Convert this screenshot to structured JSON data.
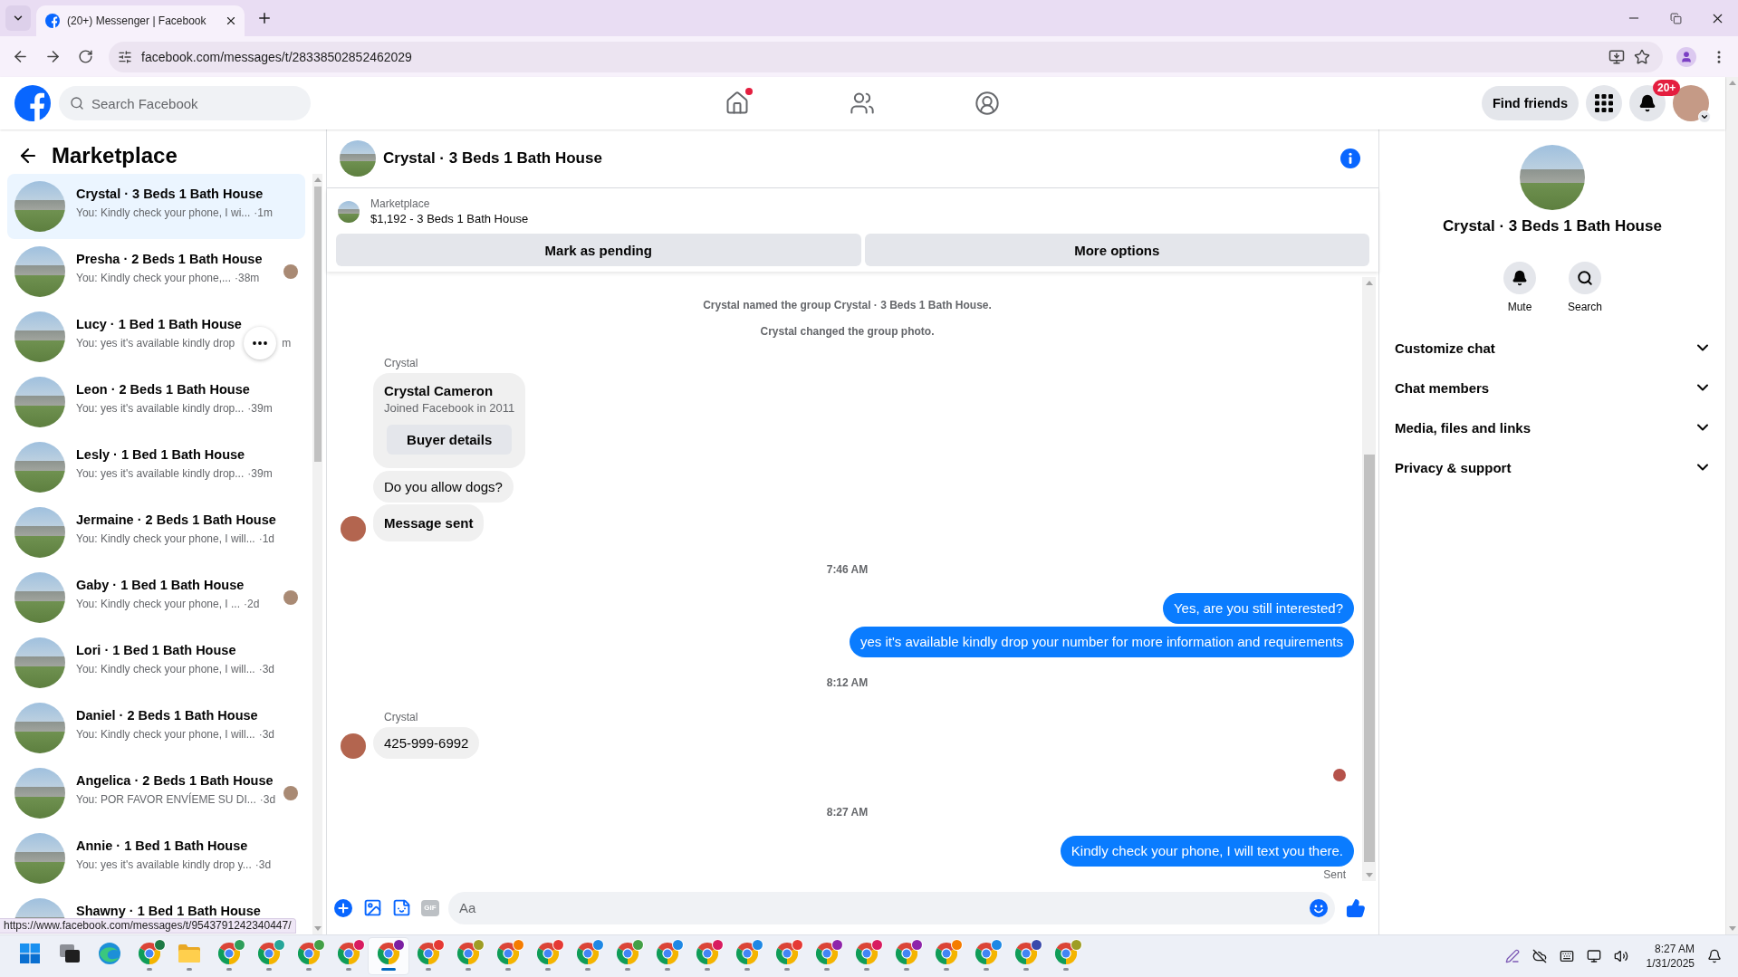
{
  "browser": {
    "tab": {
      "title": "(20+) Messenger | Facebook",
      "selected": true
    },
    "url": "facebook.com/messages/t/28338502852462029",
    "status_url": "https://www.facebook.com/messages/t/9543791242340447/"
  },
  "header": {
    "search": {
      "placeholder": "Search Facebook"
    },
    "nav": [
      {
        "kind": "home",
        "selected": false,
        "dot": true
      },
      {
        "kind": "friends",
        "selected": false,
        "dot": false
      },
      {
        "kind": "groups",
        "selected": false,
        "dot": false
      }
    ],
    "find_friends": "Find friends",
    "notifications_badge": "20+"
  },
  "sidebar": {
    "title": "Marketplace",
    "conversations": [
      {
        "name": "Crystal · 3 Beds 1 Bath House",
        "preview": "You: Kindly check your phone, I wi...",
        "time": "·1m",
        "selected": true,
        "seen": false,
        "hovered": false
      },
      {
        "name": "Presha · 2 Beds 1 Bath House",
        "preview": "You: Kindly check your phone,...",
        "time": "·38m",
        "selected": false,
        "seen": true,
        "hovered": false
      },
      {
        "name": "Lucy · 1 Bed 1 Bath House",
        "preview": "You: yes it's available kindly drop",
        "time": "m",
        "selected": false,
        "seen": false,
        "hovered": true
      },
      {
        "name": "Leon · 2 Beds 1 Bath House",
        "preview": "You: yes it's available kindly drop...",
        "time": "·39m",
        "selected": false,
        "seen": false,
        "hovered": false
      },
      {
        "name": "Lesly · 1 Bed 1 Bath House",
        "preview": "You: yes it's available kindly drop...",
        "time": "·39m",
        "selected": false,
        "seen": false,
        "hovered": false
      },
      {
        "name": "Jermaine · 2 Beds 1 Bath House",
        "preview": "You: Kindly check your phone, I will...",
        "time": "·1d",
        "selected": false,
        "seen": false,
        "hovered": false
      },
      {
        "name": "Gaby · 1 Bed 1 Bath House",
        "preview": "You: Kindly check your phone, I ...",
        "time": "·2d",
        "selected": false,
        "seen": true,
        "hovered": false
      },
      {
        "name": "Lori · 1 Bed 1 Bath House",
        "preview": "You: Kindly check your phone, I will...",
        "time": "·3d",
        "selected": false,
        "seen": false,
        "hovered": false
      },
      {
        "name": "Daniel · 2 Beds 1 Bath House",
        "preview": "You: Kindly check your phone, I will...",
        "time": "·3d",
        "selected": false,
        "seen": false,
        "hovered": false
      },
      {
        "name": "Angelica · 2 Beds 1 Bath House",
        "preview": "You: POR FAVOR ENVÍEME SU DI...",
        "time": "·3d",
        "selected": false,
        "seen": true,
        "hovered": false
      },
      {
        "name": "Annie · 1 Bed 1 Bath House",
        "preview": "You: yes it's available kindly drop y...",
        "time": "·3d",
        "selected": false,
        "seen": false,
        "hovered": false
      },
      {
        "name": "Shawny · 1 Bed 1 Bath House",
        "selected": false,
        "seen": false,
        "hovered": false
      }
    ]
  },
  "chat": {
    "title": "Crystal · 3 Beds 1 Bath House",
    "listing": {
      "label": "Marketplace",
      "text": "$1,192 - 3 Beds 1 Bath House"
    },
    "actions": [
      "Mark as pending",
      "More options"
    ],
    "messages": [
      {
        "kind": "system",
        "text": "Crystal named the group Crystal · 3 Beds 1 Bath House."
      },
      {
        "kind": "system",
        "text": "Crystal changed the group photo."
      },
      {
        "kind": "sender",
        "text": "Crystal"
      },
      {
        "kind": "card",
        "title": "Crystal Cameron",
        "subtitle": "Joined Facebook in 2011",
        "button": "Buyer details"
      },
      {
        "kind": "incoming",
        "text": "Do you allow dogs?",
        "bold": false,
        "avatar": false
      },
      {
        "kind": "incoming",
        "text": "Message sent",
        "bold": true,
        "avatar": true
      },
      {
        "kind": "time",
        "text": "7:46 AM"
      },
      {
        "kind": "outgoing",
        "text": "Yes, are you still interested?"
      },
      {
        "kind": "outgoing",
        "text": "yes it's available kindly drop your number for more information and requirements"
      },
      {
        "kind": "time",
        "text": "8:12 AM"
      },
      {
        "kind": "sender",
        "text": "Crystal"
      },
      {
        "kind": "incoming",
        "text": "425-999-6992",
        "bold": false,
        "avatar": true
      },
      {
        "kind": "seen"
      },
      {
        "kind": "time",
        "text": "8:27 AM"
      },
      {
        "kind": "outgoing",
        "text": "Kindly check your phone, I will text you there."
      },
      {
        "kind": "receipt",
        "text": "Sent"
      }
    ],
    "composer": {
      "placeholder": "Aa",
      "gif": "GIF"
    }
  },
  "details": {
    "title": "Crystal · 3 Beds 1 Bath House",
    "actions": [
      {
        "kind": "mute",
        "label": "Mute"
      },
      {
        "kind": "search",
        "label": "Search"
      }
    ],
    "sections": [
      {
        "label": "Customize chat",
        "expanded": false
      },
      {
        "label": "Chat members",
        "expanded": false
      },
      {
        "label": "Media, files and links",
        "expanded": false
      },
      {
        "label": "Privacy & support",
        "expanded": false
      }
    ]
  },
  "taskbar": {
    "apps": [
      {
        "kind": "start",
        "selected": false,
        "running": false
      },
      {
        "kind": "task-view",
        "selected": false,
        "running": false
      },
      {
        "kind": "edge",
        "selected": false,
        "running": false
      },
      {
        "kind": "browser",
        "color": "#1e7a45",
        "selected": false,
        "running": true
      },
      {
        "kind": "folder",
        "selected": false,
        "running": true
      },
      {
        "kind": "browser",
        "color": "#2e9e5b",
        "selected": false,
        "running": true
      },
      {
        "kind": "browser",
        "color": "#26a69a",
        "selected": false,
        "running": true
      },
      {
        "kind": "browser",
        "color": "#43a047",
        "selected": false,
        "running": true
      },
      {
        "kind": "browser",
        "color": "#d81b60",
        "selected": false,
        "running": true
      },
      {
        "kind": "browser",
        "color": "#7b1fa2",
        "selected": true,
        "running": true
      },
      {
        "kind": "browser",
        "color": "#e53935",
        "selected": false,
        "running": true
      },
      {
        "kind": "browser",
        "color": "#9e9d24",
        "selected": false,
        "running": true
      },
      {
        "kind": "browser",
        "color": "#f57c00",
        "selected": false,
        "running": true
      },
      {
        "kind": "browser",
        "color": "#e53935",
        "selected": false,
        "running": true
      },
      {
        "kind": "browser",
        "color": "#1e88e5",
        "selected": false,
        "running": true
      },
      {
        "kind": "browser",
        "color": "#43a047",
        "selected": false,
        "running": true
      },
      {
        "kind": "browser",
        "color": "#1e88e5",
        "selected": false,
        "running": true
      },
      {
        "kind": "browser",
        "color": "#d81b60",
        "selected": false,
        "running": true
      },
      {
        "kind": "browser",
        "color": "#1e88e5",
        "selected": false,
        "running": true
      },
      {
        "kind": "browser",
        "color": "#e53935",
        "selected": false,
        "running": true
      },
      {
        "kind": "browser",
        "color": "#8e24aa",
        "selected": false,
        "running": true
      },
      {
        "kind": "browser",
        "color": "#d81b60",
        "selected": false,
        "running": true
      },
      {
        "kind": "browser",
        "color": "#8e24aa",
        "selected": false,
        "running": true
      },
      {
        "kind": "browser",
        "color": "#f57c00",
        "selected": false,
        "running": true
      },
      {
        "kind": "browser",
        "color": "#1e88e5",
        "selected": false,
        "running": true
      },
      {
        "kind": "browser",
        "color": "#3949ab",
        "selected": false,
        "running": true
      },
      {
        "kind": "browser",
        "color": "#9e9d24",
        "selected": false,
        "running": true
      }
    ],
    "time": "8:27 AM",
    "date": "1/31/2025"
  }
}
